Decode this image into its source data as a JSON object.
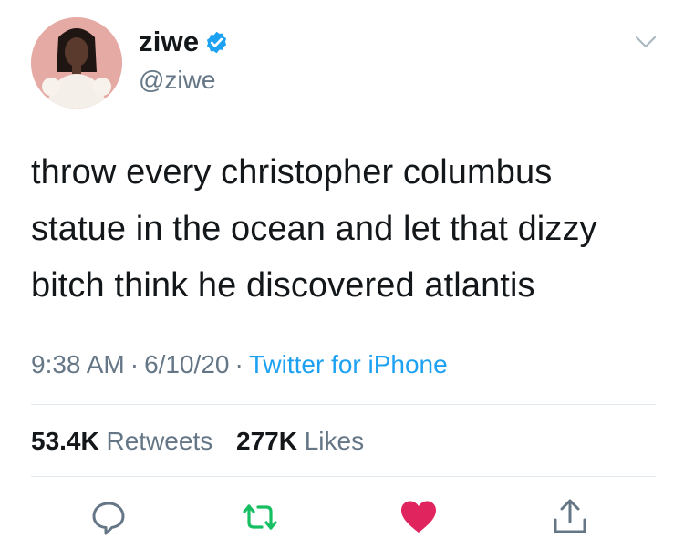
{
  "user": {
    "display_name": "ziwe",
    "handle": "@ziwe",
    "verified": true
  },
  "tweet": {
    "lines": [
      "throw every christopher columbus",
      "statue in the ocean and let that dizzy",
      "bitch think he discovered atlantis"
    ],
    "time": "9:38 AM",
    "date": "6/10/20",
    "source": "Twitter for iPhone",
    "separator": "·"
  },
  "stats": {
    "retweets_count": "53.4K",
    "retweets_label": "Retweets",
    "likes_count": "277K",
    "likes_label": "Likes"
  },
  "actions": [
    "reply-icon",
    "retweet-icon",
    "like-icon",
    "share-icon"
  ],
  "colors": {
    "text": "#14171a",
    "secondary": "#657786",
    "link": "#1da1f2",
    "verified": "#1da1f2",
    "retweet": "#17bf63",
    "like": "#e0245e",
    "divider": "#e1e8ed"
  }
}
